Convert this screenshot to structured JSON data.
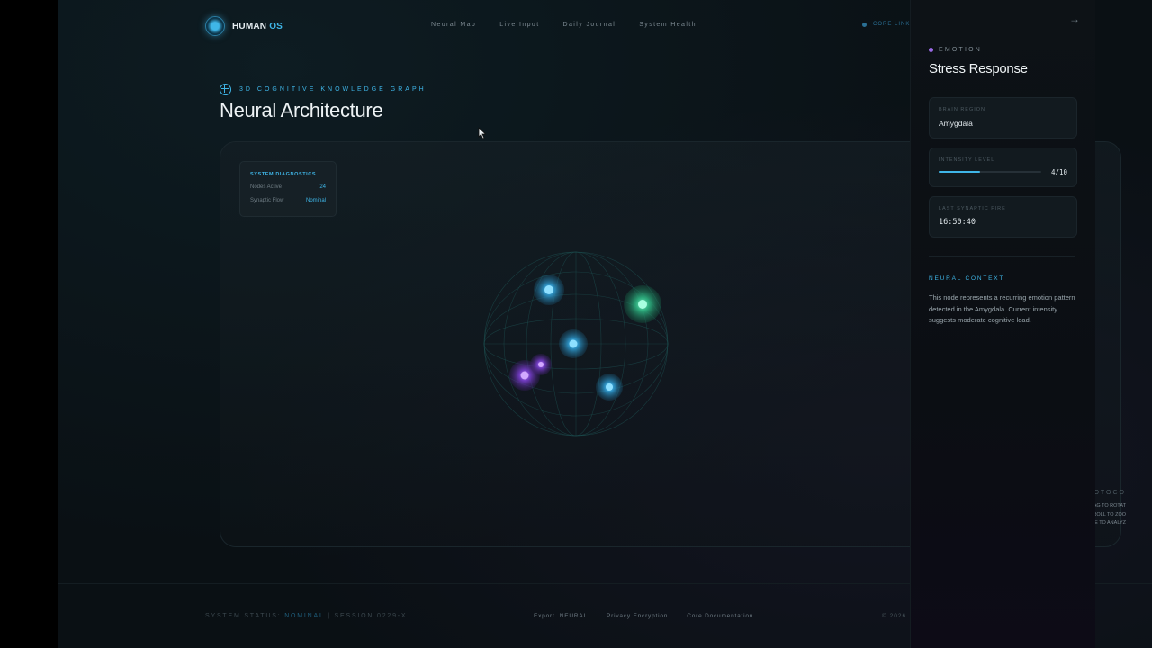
{
  "header": {
    "logo_primary": "HUMAN",
    "logo_secondary": "OS",
    "nav": [
      "Neural Map",
      "Live Input",
      "Daily Journal",
      "System Health"
    ],
    "core_status": "CORE LINKE"
  },
  "main": {
    "kicker": "3D COGNITIVE KNOWLEDGE GRAPH",
    "title": "Neural Architecture",
    "diagnostics": {
      "title": "SYSTEM DIAGNOSTICS",
      "nodes_label": "Nodes Active",
      "nodes_value": "24",
      "flow_label": "Synaptic Flow",
      "flow_value": "Nominal"
    },
    "protocol": {
      "title": "INTERACTION PROTOCO",
      "lines": [
        "DRAG TO ROTAT",
        "SCROLL TO ZOO",
        "CLICK NODE TO ANALYZ"
      ]
    },
    "nodes": [
      {
        "id": "node-blue-1",
        "color": "#3fb6e8"
      },
      {
        "id": "node-green",
        "color": "#32d49a"
      },
      {
        "id": "node-blue-2",
        "color": "#3fb6e8"
      },
      {
        "id": "node-purple-1",
        "color": "#9a4ee6"
      },
      {
        "id": "node-purple-2",
        "color": "#a86af0"
      },
      {
        "id": "node-blue-3",
        "color": "#3fb6e8"
      }
    ]
  },
  "footer": {
    "status_prefix": "SYSTEM STATUS:",
    "status_value": "NOMINAL",
    "session": "| SESSION 0229-X",
    "links": [
      "Export .NEURAL",
      "Privacy Encryption",
      "Core Documentation"
    ],
    "copyright": "© 2026"
  },
  "side": {
    "category": "EMOTION",
    "title": "Stress Response",
    "region_label": "BRAIN REGION",
    "region_value": "Amygdala",
    "intensity_label": "INTENSITY LEVEL",
    "intensity_value": "4/10",
    "intensity_fraction": 0.4,
    "fire_label": "LAST SYNAPTIC FIRE",
    "fire_value": "16:50:40",
    "context_heading": "NEURAL CONTEXT",
    "context_body": "This node represents a recurring emotion pattern detected in the Amygdala. Current intensity suggests moderate cognitive load."
  },
  "colors": {
    "accent": "#3fb6e8",
    "emotion": "#9a6ae6",
    "background": "#0a1014"
  }
}
